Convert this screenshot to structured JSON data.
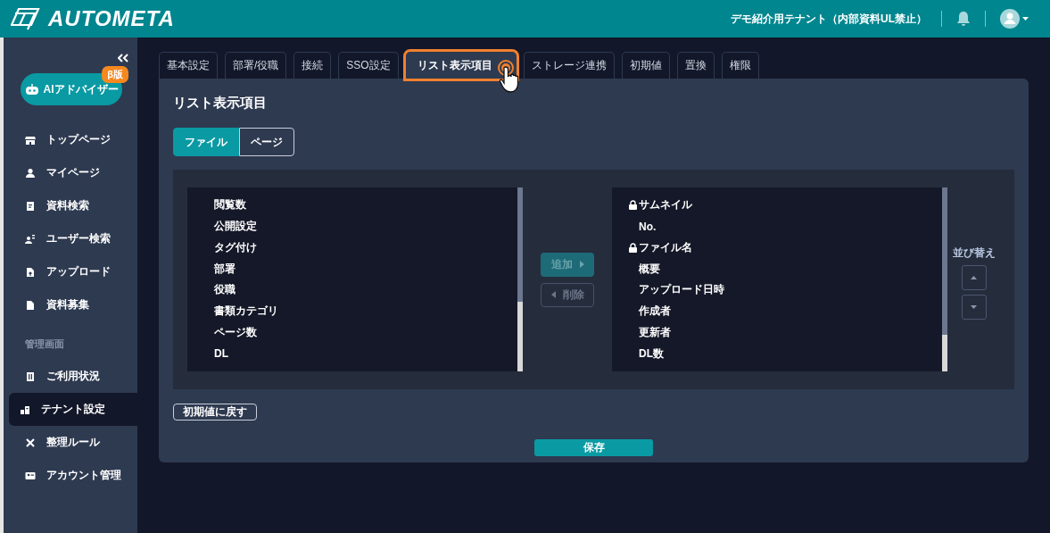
{
  "header": {
    "logo": "AUTOMETA",
    "tenant": "デモ紹介用テナント（内部資料UL禁止）"
  },
  "sidebar": {
    "ai_button": {
      "label": "AIアドバイザー",
      "badge": "β版"
    },
    "items": [
      {
        "label": "トップページ",
        "selected": false
      },
      {
        "label": "マイページ",
        "selected": false
      },
      {
        "label": "資料検索",
        "selected": false
      },
      {
        "label": "ユーザー検索",
        "selected": false
      },
      {
        "label": "アップロード",
        "selected": false
      },
      {
        "label": "資料募集",
        "selected": false
      }
    ],
    "section": "管理画面",
    "admin_items": [
      {
        "label": "ご利用状況",
        "selected": false
      },
      {
        "label": "テナント設定",
        "selected": true
      },
      {
        "label": "整理ルール",
        "selected": false
      },
      {
        "label": "アカウント管理",
        "selected": false
      }
    ]
  },
  "tabs": [
    {
      "label": "基本設定",
      "selected": false,
      "highlighted": false
    },
    {
      "label": "部署/役職",
      "selected": false,
      "highlighted": false
    },
    {
      "label": "接続",
      "selected": false,
      "highlighted": false
    },
    {
      "label": "SSO設定",
      "selected": false,
      "highlighted": false
    },
    {
      "label": "リスト表示項目",
      "selected": true,
      "highlighted": true
    },
    {
      "label": "ストレージ連携",
      "selected": false,
      "highlighted": false
    },
    {
      "label": "初期値",
      "selected": false,
      "highlighted": false
    },
    {
      "label": "置換",
      "selected": false,
      "highlighted": false
    },
    {
      "label": "権限",
      "selected": false,
      "highlighted": false
    }
  ],
  "panel": {
    "title": "リスト表示項目",
    "segments": [
      {
        "label": "ファイル",
        "selected": true
      },
      {
        "label": "ページ",
        "selected": false
      }
    ],
    "available": [
      {
        "label": "閲覧数"
      },
      {
        "label": "公開設定"
      },
      {
        "label": "タグ付け"
      },
      {
        "label": "部署"
      },
      {
        "label": "役職"
      },
      {
        "label": "書類カテゴリ"
      },
      {
        "label": "ページ数"
      },
      {
        "label": "DL"
      }
    ],
    "add_button": {
      "label": "追加",
      "disabled": true
    },
    "remove_button": {
      "label": "削除",
      "disabled": true
    },
    "displayed": [
      {
        "label": "サムネイル",
        "locked": true
      },
      {
        "label": "No.",
        "locked": false
      },
      {
        "label": "ファイル名",
        "locked": true
      },
      {
        "label": "概要",
        "locked": false
      },
      {
        "label": "アップロード日時",
        "locked": false
      },
      {
        "label": "作成者",
        "locked": false
      },
      {
        "label": "更新者",
        "locked": false
      },
      {
        "label": "DL数",
        "locked": false
      }
    ],
    "sort_label": "並び替え",
    "reset_button": "初期値に戻す",
    "save_button": "保存"
  }
}
